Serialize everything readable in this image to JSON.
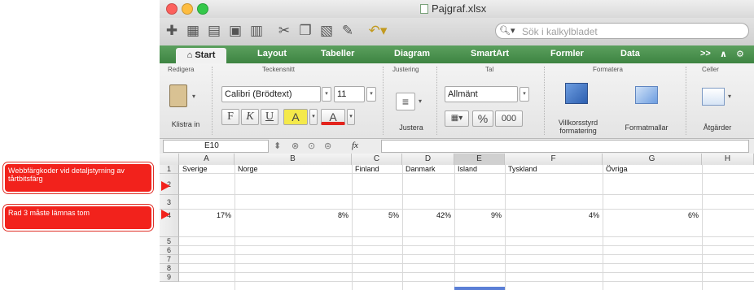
{
  "window": {
    "title": "Pajgraf.xlsx"
  },
  "search": {
    "placeholder": "Sök i kalkylbladet"
  },
  "tabs": [
    "Start",
    "Layout",
    "Tabeller",
    "Diagram",
    "SmartArt",
    "Formler",
    "Data"
  ],
  "ribbon": {
    "groups": [
      "Redigera",
      "Teckensnitt",
      "Justering",
      "Tal",
      "Formatera",
      "Celler"
    ],
    "paste_label": "Klistra in",
    "font_name": "Calibri (Brödtext)",
    "font_size": "11",
    "bold": "F",
    "italic": "K",
    "underline": "U",
    "fill_color": "A",
    "font_color": "A",
    "align_label": "Justera",
    "number_format": "Allmänt",
    "percent": "%",
    "thousands": "000",
    "conditional_label": "Villkorsstyrd formatering",
    "styles_label": "Formatmallar",
    "actions_label": "Åtgärder"
  },
  "formula_bar": {
    "name_box": "E10",
    "fx": "fx",
    "value": ""
  },
  "sheet": {
    "columns": [
      "A",
      "B",
      "C",
      "D",
      "E",
      "F",
      "G",
      "H"
    ],
    "rows": [
      "1",
      "2",
      "3",
      "4",
      "5",
      "6",
      "7",
      "8",
      "9"
    ],
    "header_row": [
      "Sverige",
      "Norge",
      "Finland",
      "Danmark",
      "Island",
      "Tyskland",
      "Övriga"
    ],
    "value_row": [
      "17%",
      "8%",
      "5%",
      "42%",
      "9%",
      "4%",
      "6%"
    ]
  },
  "callouts": {
    "first": "Webbfärgkoder vid detaljstyrning av tårtbitsfärg",
    "second": "Rad 3 måste lämnas tom"
  },
  "colors": {
    "tab_bar": "#4a914d",
    "callout": "#f2221c",
    "selected_column": "#5b7fd6"
  }
}
